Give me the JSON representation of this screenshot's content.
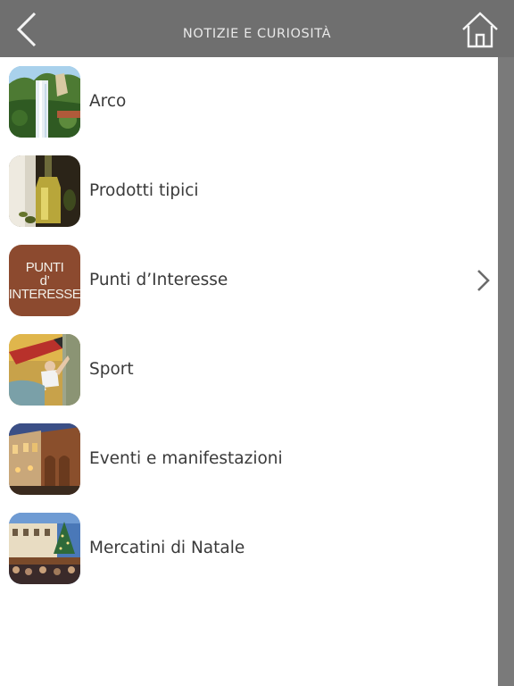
{
  "header": {
    "title": "NOTIZIE E CURIOSITÀ",
    "back_icon": "chevron-left-icon",
    "home_icon": "home-icon",
    "bg_color": "#6f6f6f"
  },
  "list": {
    "items": [
      {
        "label": "Arco",
        "thumb": "waterfall-garden-image"
      },
      {
        "label": "Prodotti tipici",
        "thumb": "olive-oil-bottle-image"
      },
      {
        "label": "Punti d’Interesse",
        "thumb": "punti-interesse-badge",
        "thumb_text": [
          "PUNTI",
          "d’",
          "INTERESSE"
        ],
        "has_chevron": true
      },
      {
        "label": "Sport",
        "thumb": "climber-image"
      },
      {
        "label": "Eventi e manifestazioni",
        "thumb": "evening-street-image"
      },
      {
        "label": "Mercatini di Natale",
        "thumb": "christmas-market-image"
      }
    ]
  }
}
